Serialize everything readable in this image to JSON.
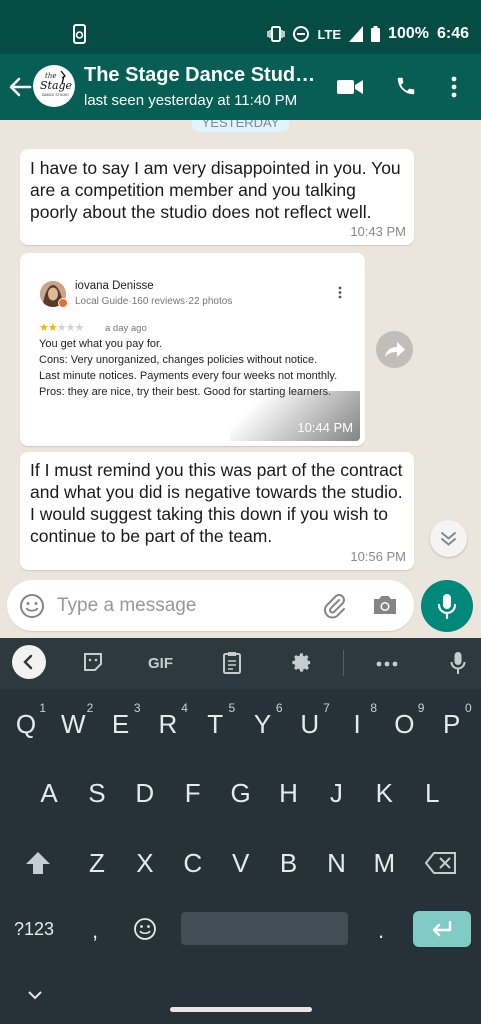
{
  "status_bar": {
    "network": "LTE",
    "battery": "100%",
    "time": "6:46"
  },
  "header": {
    "contact_name": "The Stage Dance Studi…",
    "last_seen": "last seen yesterday at 11:40 PM",
    "avatar_text": {
      "line1": "the",
      "line2": "Stage",
      "line3": "DANCE STUDIO"
    }
  },
  "chat": {
    "date_divider": "YESTERDAY",
    "messages": [
      {
        "text": "I have to say I am very disappointed in you. You are a competition member and you talking poorly about the studio does not reflect well.",
        "time": "10:43 PM"
      },
      {
        "type": "image",
        "time": "10:44 PM",
        "review": {
          "name": "iovana Denisse",
          "meta": "Local Guide·160 reviews·22 photos",
          "stars": 2,
          "max_stars": 5,
          "posted": "a day ago",
          "body": [
            "You get what you pay for.",
            "Cons: Very unorganized, changes policies without notice.",
            "Last minute notices. Payments every four weeks not monthly.",
            "Pros: they are nice, try their best. Good for starting learners."
          ]
        }
      },
      {
        "text": "If I must remind you this was part of the contract and what you did is negative towards the studio. I would suggest taking this down if you wish to continue to be part of the team.",
        "time": "10:56 PM"
      }
    ]
  },
  "composer": {
    "placeholder": "Type a message"
  },
  "keyboard": {
    "toolbar": {
      "gif_label": "GIF"
    },
    "row1": [
      {
        "k": "Q",
        "n": "1"
      },
      {
        "k": "W",
        "n": "2"
      },
      {
        "k": "E",
        "n": "3"
      },
      {
        "k": "R",
        "n": "4"
      },
      {
        "k": "T",
        "n": "5"
      },
      {
        "k": "Y",
        "n": "6"
      },
      {
        "k": "U",
        "n": "7"
      },
      {
        "k": "I",
        "n": "8"
      },
      {
        "k": "O",
        "n": "9"
      },
      {
        "k": "P",
        "n": "0"
      }
    ],
    "row2": [
      "A",
      "S",
      "D",
      "F",
      "G",
      "H",
      "J",
      "K",
      "L"
    ],
    "row3": [
      "Z",
      "X",
      "C",
      "V",
      "B",
      "N",
      "M"
    ],
    "symbols_label": "?123",
    "comma": ",",
    "period": "."
  },
  "colors": {
    "header": "#075E54",
    "status": "#054D44",
    "accent": "#00897B",
    "chat_bg": "#ECE5DD",
    "keyboard": "#263238"
  }
}
